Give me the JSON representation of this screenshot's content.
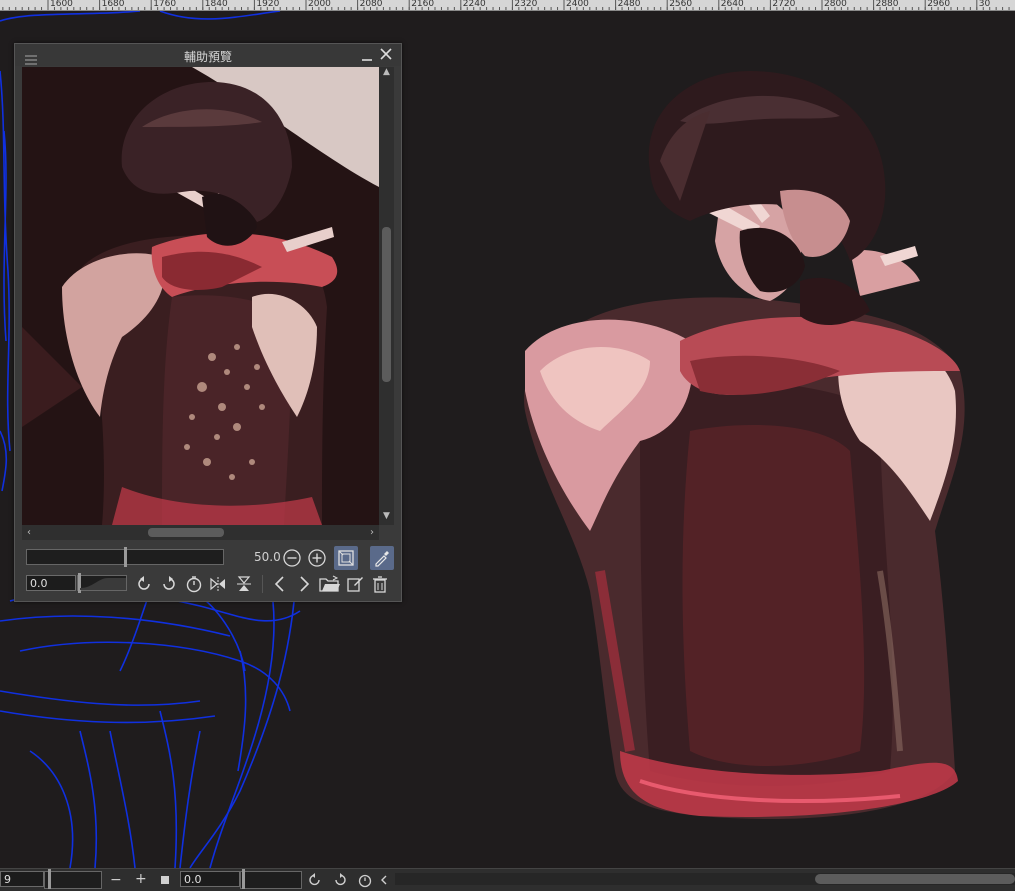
{
  "ruler": {
    "labels": [
      "1600",
      "1680",
      "1760",
      "1840",
      "1920",
      "2000",
      "2080",
      "2160",
      "2240",
      "2320",
      "2400",
      "2480",
      "2560",
      "2640",
      "2720",
      "2800",
      "2880",
      "2960",
      "30"
    ]
  },
  "subview": {
    "title": "輔助預覽",
    "zoom_value": "50.0",
    "rotation_value": "0.0",
    "icons": {
      "menu": "hamburger-menu-icon",
      "minimize": "minimize-icon",
      "close": "close-icon",
      "zoom_out": "zoom-out-icon",
      "zoom_in": "zoom-in-icon",
      "fit": "fit-to-window-icon",
      "eyedropper": "eyedropper-icon",
      "rotate_left": "rotate-left-icon",
      "rotate_right": "rotate-right-icon",
      "reset_rotation": "reset-rotation-icon",
      "flip_horizontal": "flip-horizontal-icon",
      "flip_vertical": "flip-vertical-icon",
      "previous": "previous-icon",
      "next": "next-icon",
      "import": "import-image-icon",
      "clear": "clear-icon",
      "delete": "delete-icon"
    }
  },
  "statusbar": {
    "zoom_value": "9",
    "rotation_value": "0.0",
    "zoom_out_label": "−",
    "zoom_in_label": "+"
  },
  "colors": {
    "canvas_bg": "#1f1c1d",
    "sketch_blue": "#1030e0",
    "accent_active": "#5a6a8a"
  }
}
